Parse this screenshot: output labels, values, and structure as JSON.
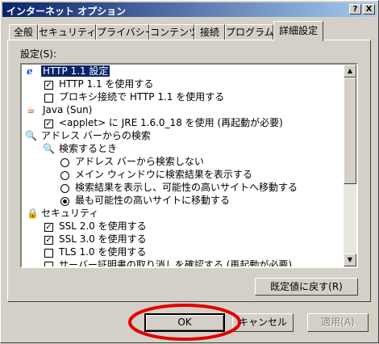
{
  "window": {
    "title": "インターネット オプション",
    "help_glyph": "?",
    "close_glyph": "X"
  },
  "tabs": [
    "全般",
    "セキュリティ",
    "プライバシー",
    "コンテンツ",
    "接続",
    "プログラム",
    "詳細設定"
  ],
  "settings_label": "設定(S):",
  "list": {
    "http_header": "HTTP 1.1 設定",
    "http11_use": "HTTP 1.1 を使用する",
    "http11_proxy": "プロキシ接続で HTTP 1.1 を使用する",
    "java_header": "Java (Sun)",
    "java_applet": "<applet> に JRE 1.6.0_18 を使用 (再起動が必要)",
    "search_header": "アドレス バーからの検索",
    "search_sub": "検索するとき",
    "radio_1": "アドレス バーから検索しない",
    "radio_2": "メイン ウィンドウに検索結果を表示する",
    "radio_3": "検索結果を表示し、可能性の高いサイトへ移動する",
    "radio_4": "最も可能性の高いサイトに移動する",
    "security_header": "セキュリティ",
    "ssl2": "SSL 2.0 を使用する",
    "ssl3": "SSL 3.0 を使用する",
    "tls1": "TLS 1.0 を使用する",
    "cert_revoke": "サーバー証明書の取り消しを確認する (再起動が必要)"
  },
  "buttons": {
    "restore": "既定値に戻す(R)",
    "ok": "OK",
    "cancel": "キャンセル",
    "apply": "適用(A)"
  },
  "icons": {
    "ie": "ie-icon",
    "java": "java-icon",
    "search": "magnifier-icon",
    "security": "lock-icon"
  },
  "colors": {
    "titlebar": "#0a246a",
    "selection": "#0a246a",
    "annotation": "#e00000",
    "face": "#d4d0c8"
  }
}
